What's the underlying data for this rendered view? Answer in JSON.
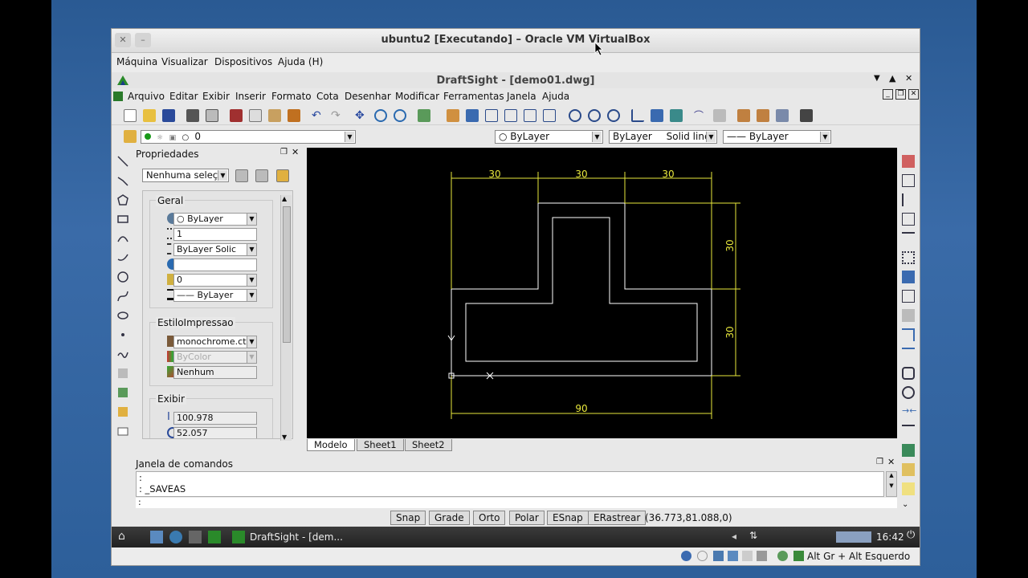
{
  "vbox": {
    "title": "ubuntu2 [Executando] – Oracle VM VirtualBox",
    "menu": [
      "Máquina",
      "Visualizar",
      "Dispositivos",
      "Ajuda (H)"
    ],
    "host_key": "Alt Gr + Alt Esquerdo"
  },
  "app": {
    "title": "DraftSight - [demo01.dwg]",
    "menu": [
      "Arquivo",
      "Editar",
      "Exibir",
      "Inserir",
      "Formato",
      "Cota",
      "Desenhar",
      "Modificar",
      "Ferramentas",
      "Janela",
      "Ajuda"
    ]
  },
  "layerbar": {
    "layer": "0",
    "color": "ByLayer",
    "linetype": "ByLayer",
    "linetype_desc": "Solid line",
    "lineweight": "ByLayer"
  },
  "props": {
    "title": "Propriedades",
    "selection": "Nenhuma seleçã",
    "geral_label": "Geral",
    "geral": [
      "ByLayer",
      "1",
      "ByLayer     Solic",
      "",
      "0",
      "ByLayer"
    ],
    "estilo_label": "EstiloImpressao",
    "estilo": [
      "monochrome.ctl",
      "ByColor",
      "Nenhum"
    ],
    "exibir_label": "Exibir",
    "exibir": [
      "100.978",
      "52.057"
    ]
  },
  "drawing": {
    "dims": [
      "30",
      "30",
      "30",
      "30",
      "30",
      "90"
    ]
  },
  "tabs": [
    "Modelo",
    "Sheet1",
    "Sheet2"
  ],
  "command": {
    "title": "Janela de comandos",
    "lines": [
      ":",
      ": _SAVEAS",
      ":"
    ]
  },
  "status": {
    "buttons": [
      "Snap",
      "Grade",
      "Orto",
      "Polar",
      "ESnap",
      "ERastrear"
    ],
    "coords": "(36.773,81.088,0)"
  },
  "taskbar": {
    "task": "DraftSight - [dem...",
    "time": "16:42"
  },
  "colors": {
    "dim": "#e8e83c",
    "geom": "#ffffff",
    "canvas": "#000000"
  }
}
